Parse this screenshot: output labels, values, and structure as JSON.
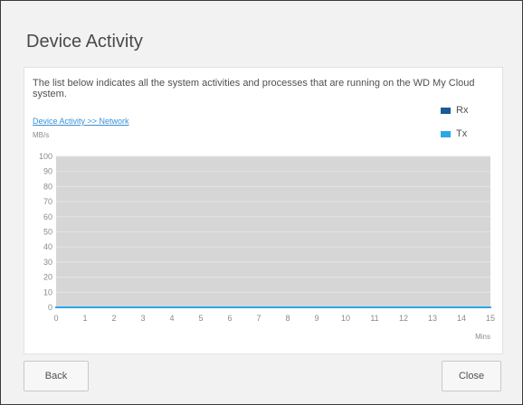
{
  "dialog": {
    "title": "Device Activity",
    "description": "The list below indicates all the system activities and processes that are running on the WD My Cloud system.",
    "breadcrumb_link": "Device Activity >> Network",
    "back_label": "Back",
    "close_label": "Close"
  },
  "colors": {
    "rx": "#1a5a96",
    "tx": "#2aa8e8",
    "plot_bg": "#d6d6d6"
  },
  "chart_data": {
    "type": "area",
    "ylabel": "MB/s",
    "xlabel": "Mins",
    "x": [
      0,
      1,
      2,
      3,
      4,
      5,
      6,
      7,
      8,
      9,
      10,
      11,
      12,
      13,
      14,
      15
    ],
    "xlim": [
      0,
      15
    ],
    "ylim": [
      0,
      100
    ],
    "yticks": [
      0,
      10,
      20,
      30,
      40,
      50,
      60,
      70,
      80,
      90,
      100
    ],
    "xticks": [
      0,
      1,
      2,
      3,
      4,
      5,
      6,
      7,
      8,
      9,
      10,
      11,
      12,
      13,
      14,
      15
    ],
    "series": [
      {
        "name": "Rx",
        "values": [
          0,
          0,
          0,
          0,
          0,
          0,
          0,
          0,
          0,
          0,
          0,
          0,
          0,
          0,
          0,
          0
        ]
      },
      {
        "name": "Tx",
        "values": [
          0,
          0,
          0,
          0,
          0,
          0,
          0,
          0,
          0,
          0,
          0,
          0,
          0,
          0,
          0,
          0
        ]
      }
    ],
    "grid": true,
    "legend": "top-right"
  }
}
